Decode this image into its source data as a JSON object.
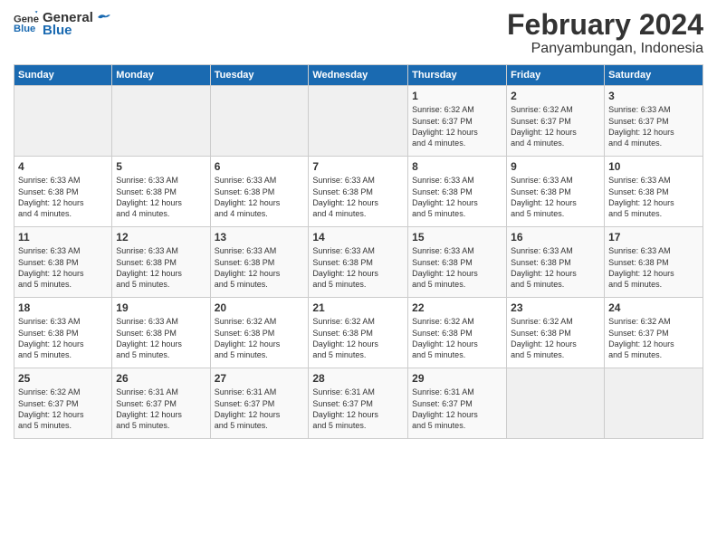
{
  "logo": {
    "line1": "General",
    "line2": "Blue"
  },
  "title": "February 2024",
  "subtitle": "Panyambungan, Indonesia",
  "days_of_week": [
    "Sunday",
    "Monday",
    "Tuesday",
    "Wednesday",
    "Thursday",
    "Friday",
    "Saturday"
  ],
  "weeks": [
    [
      {
        "day": "",
        "info": ""
      },
      {
        "day": "",
        "info": ""
      },
      {
        "day": "",
        "info": ""
      },
      {
        "day": "",
        "info": ""
      },
      {
        "day": "1",
        "info": "Sunrise: 6:32 AM\nSunset: 6:37 PM\nDaylight: 12 hours\nand 4 minutes."
      },
      {
        "day": "2",
        "info": "Sunrise: 6:32 AM\nSunset: 6:37 PM\nDaylight: 12 hours\nand 4 minutes."
      },
      {
        "day": "3",
        "info": "Sunrise: 6:33 AM\nSunset: 6:37 PM\nDaylight: 12 hours\nand 4 minutes."
      }
    ],
    [
      {
        "day": "4",
        "info": "Sunrise: 6:33 AM\nSunset: 6:38 PM\nDaylight: 12 hours\nand 4 minutes."
      },
      {
        "day": "5",
        "info": "Sunrise: 6:33 AM\nSunset: 6:38 PM\nDaylight: 12 hours\nand 4 minutes."
      },
      {
        "day": "6",
        "info": "Sunrise: 6:33 AM\nSunset: 6:38 PM\nDaylight: 12 hours\nand 4 minutes."
      },
      {
        "day": "7",
        "info": "Sunrise: 6:33 AM\nSunset: 6:38 PM\nDaylight: 12 hours\nand 4 minutes."
      },
      {
        "day": "8",
        "info": "Sunrise: 6:33 AM\nSunset: 6:38 PM\nDaylight: 12 hours\nand 5 minutes."
      },
      {
        "day": "9",
        "info": "Sunrise: 6:33 AM\nSunset: 6:38 PM\nDaylight: 12 hours\nand 5 minutes."
      },
      {
        "day": "10",
        "info": "Sunrise: 6:33 AM\nSunset: 6:38 PM\nDaylight: 12 hours\nand 5 minutes."
      }
    ],
    [
      {
        "day": "11",
        "info": "Sunrise: 6:33 AM\nSunset: 6:38 PM\nDaylight: 12 hours\nand 5 minutes."
      },
      {
        "day": "12",
        "info": "Sunrise: 6:33 AM\nSunset: 6:38 PM\nDaylight: 12 hours\nand 5 minutes."
      },
      {
        "day": "13",
        "info": "Sunrise: 6:33 AM\nSunset: 6:38 PM\nDaylight: 12 hours\nand 5 minutes."
      },
      {
        "day": "14",
        "info": "Sunrise: 6:33 AM\nSunset: 6:38 PM\nDaylight: 12 hours\nand 5 minutes."
      },
      {
        "day": "15",
        "info": "Sunrise: 6:33 AM\nSunset: 6:38 PM\nDaylight: 12 hours\nand 5 minutes."
      },
      {
        "day": "16",
        "info": "Sunrise: 6:33 AM\nSunset: 6:38 PM\nDaylight: 12 hours\nand 5 minutes."
      },
      {
        "day": "17",
        "info": "Sunrise: 6:33 AM\nSunset: 6:38 PM\nDaylight: 12 hours\nand 5 minutes."
      }
    ],
    [
      {
        "day": "18",
        "info": "Sunrise: 6:33 AM\nSunset: 6:38 PM\nDaylight: 12 hours\nand 5 minutes."
      },
      {
        "day": "19",
        "info": "Sunrise: 6:33 AM\nSunset: 6:38 PM\nDaylight: 12 hours\nand 5 minutes."
      },
      {
        "day": "20",
        "info": "Sunrise: 6:32 AM\nSunset: 6:38 PM\nDaylight: 12 hours\nand 5 minutes."
      },
      {
        "day": "21",
        "info": "Sunrise: 6:32 AM\nSunset: 6:38 PM\nDaylight: 12 hours\nand 5 minutes."
      },
      {
        "day": "22",
        "info": "Sunrise: 6:32 AM\nSunset: 6:38 PM\nDaylight: 12 hours\nand 5 minutes."
      },
      {
        "day": "23",
        "info": "Sunrise: 6:32 AM\nSunset: 6:38 PM\nDaylight: 12 hours\nand 5 minutes."
      },
      {
        "day": "24",
        "info": "Sunrise: 6:32 AM\nSunset: 6:37 PM\nDaylight: 12 hours\nand 5 minutes."
      }
    ],
    [
      {
        "day": "25",
        "info": "Sunrise: 6:32 AM\nSunset: 6:37 PM\nDaylight: 12 hours\nand 5 minutes."
      },
      {
        "day": "26",
        "info": "Sunrise: 6:31 AM\nSunset: 6:37 PM\nDaylight: 12 hours\nand 5 minutes."
      },
      {
        "day": "27",
        "info": "Sunrise: 6:31 AM\nSunset: 6:37 PM\nDaylight: 12 hours\nand 5 minutes."
      },
      {
        "day": "28",
        "info": "Sunrise: 6:31 AM\nSunset: 6:37 PM\nDaylight: 12 hours\nand 5 minutes."
      },
      {
        "day": "29",
        "info": "Sunrise: 6:31 AM\nSunset: 6:37 PM\nDaylight: 12 hours\nand 5 minutes."
      },
      {
        "day": "",
        "info": ""
      },
      {
        "day": "",
        "info": ""
      }
    ]
  ]
}
